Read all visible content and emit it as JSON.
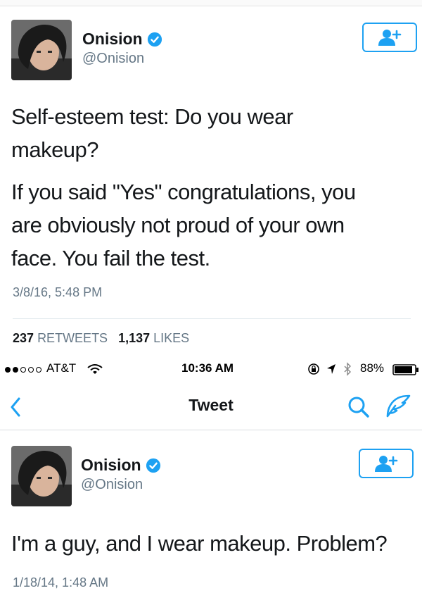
{
  "tweet1": {
    "display_name": "Onision",
    "handle": "@Onision",
    "text_p1_line1": "Self-esteem test: Do you wear",
    "text_p1_line2": "makeup?",
    "text_p2_line1": "If you said \"Yes\" congratulations, you",
    "text_p2_line2": "are obviously not proud of your own",
    "text_p2_line3": "face. You fail the test.",
    "timestamp": "3/8/16, 5:48 PM",
    "retweets_count": "237",
    "retweets_label": "RETWEETS",
    "likes_count": "1,137",
    "likes_label": "LIKES"
  },
  "status_bar": {
    "carrier": "AT&T",
    "time": "10:36 AM",
    "battery": "88%"
  },
  "nav": {
    "title": "Tweet"
  },
  "tweet2": {
    "display_name": "Onision",
    "handle": "@Onision",
    "text": "I'm a guy, and I wear makeup. Problem?",
    "timestamp": "1/18/14, 1:48 AM"
  },
  "colors": {
    "accent": "#1da1f2",
    "secondary_text": "#657786",
    "primary_text": "#14171a"
  },
  "icons": [
    "verified-badge-icon",
    "follow-user-icon",
    "back-chevron-icon",
    "search-icon",
    "compose-icon",
    "wifi-icon",
    "lock-rotation-icon",
    "location-arrow-icon",
    "bluetooth-icon",
    "battery-icon",
    "signal-dots-icon"
  ]
}
